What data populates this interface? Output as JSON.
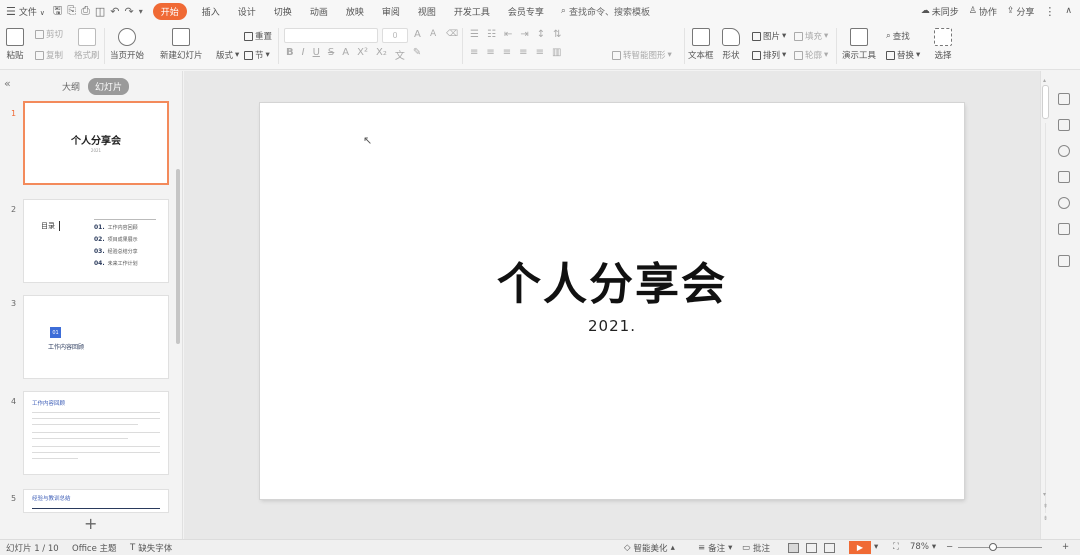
{
  "menu": {
    "file_label": "文件",
    "tabs": [
      {
        "label": "开始",
        "active": true
      },
      {
        "label": "插入",
        "active": false
      },
      {
        "label": "设计",
        "active": false
      },
      {
        "label": "切换",
        "active": false
      },
      {
        "label": "动画",
        "active": false
      },
      {
        "label": "放映",
        "active": false
      },
      {
        "label": "审阅",
        "active": false
      },
      {
        "label": "视图",
        "active": false
      },
      {
        "label": "开发工具",
        "active": false
      },
      {
        "label": "会员专享",
        "active": false
      }
    ],
    "search_text": "查找命令、搜索模板",
    "sync_label": "未同步",
    "collab_label": "协作",
    "share_label": "分享"
  },
  "ribbon": {
    "paste": "粘贴",
    "cut": "剪切",
    "copy": "复制",
    "format_painter": "格式刷",
    "from_current": "当页开始",
    "new_slide": "新建幻灯片",
    "layout": "版式",
    "section": "节",
    "reset": "重置",
    "size_placeholder": "0",
    "text_to_smartart": "转智能图形",
    "text_box": "文本框",
    "shape": "形状",
    "arrange": "排列",
    "picture": "图片",
    "fill": "填充",
    "outline": "轮廓",
    "presentation_tools": "演示工具",
    "find": "查找",
    "replace": "替换",
    "select": "选择"
  },
  "left_panel": {
    "outline_tab": "大纲",
    "slides_tab": "幻灯片",
    "slides": [
      {
        "number": "1",
        "title": "个人分享会",
        "subtitle": "2021"
      },
      {
        "number": "2",
        "title": "目录",
        "items": [
          {
            "num": "01.",
            "text": "工作内容回顾"
          },
          {
            "num": "02.",
            "text": "项目成果展示"
          },
          {
            "num": "03.",
            "text": "经验总结分享"
          },
          {
            "num": "04.",
            "text": "未来工作计划"
          }
        ]
      },
      {
        "number": "3",
        "badge": "01",
        "title": "工作内容回顾"
      },
      {
        "number": "4",
        "title": "工作内容回顾"
      },
      {
        "number": "5",
        "title": "经验与教训总结"
      }
    ]
  },
  "slide": {
    "title": "个人分享会",
    "date": "2021."
  },
  "status": {
    "slide_counter": "幻灯片 1 / 10",
    "theme": "Office 主题",
    "missing_font": "缺失字体",
    "smart_beautify": "智能美化",
    "notes": "备注",
    "comments": "批注",
    "zoom": "78%"
  }
}
